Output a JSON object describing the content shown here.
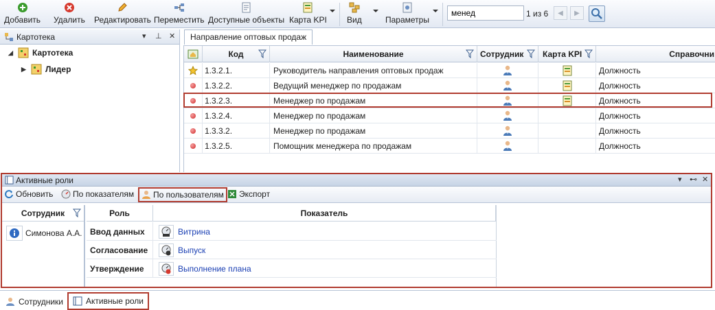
{
  "toolbar": {
    "add": "Добавить",
    "delete": "Удалить",
    "edit": "Редактировать",
    "move": "Переместить",
    "available": "Доступные объекты",
    "kpi_map": "Карта KPI",
    "view": "Вид",
    "params": "Параметры",
    "search_value": "менед",
    "search_count": "1 из 6"
  },
  "left_panel": {
    "title": "Картотека",
    "tree": [
      {
        "label": "Картотека"
      },
      {
        "label": "Лидер"
      }
    ]
  },
  "tab": {
    "label": "Направление оптовых продаж"
  },
  "grid": {
    "headers": {
      "code": "Код",
      "name": "Наименование",
      "employee": "Сотрудник",
      "kpi": "Карта KPI",
      "ref": "Справочни"
    },
    "rows": [
      {
        "marker": "star",
        "code": "1.3.2.1.",
        "name": "Руководитель направления оптовых продаж",
        "has_kpi": true,
        "ref": "Должность"
      },
      {
        "marker": "dot",
        "code": "1.3.2.2.",
        "name": "Ведущий менеджер по продажам",
        "has_kpi": true,
        "ref": "Должность"
      },
      {
        "marker": "dot",
        "code": "1.3.2.3.",
        "name": "Менеджер по продажам",
        "has_kpi": true,
        "ref": "Должность"
      },
      {
        "marker": "dot",
        "code": "1.3.2.4.",
        "name": "Менеджер по продажам",
        "has_kpi": false,
        "ref": "Должность"
      },
      {
        "marker": "dot",
        "code": "1.3.3.2.",
        "name": "Менеджер по продажам",
        "has_kpi": false,
        "ref": "Должность"
      },
      {
        "marker": "dot",
        "code": "1.3.2.5.",
        "name": "Помощник менеджера по продажам",
        "has_kpi": false,
        "ref": "Должность"
      }
    ]
  },
  "roles_panel": {
    "title": "Активные роли",
    "buttons": {
      "refresh": "Обновить",
      "by_indicators": "По показателям",
      "by_users": "По пользователям",
      "export": "Экспорт"
    },
    "employee_header": "Сотрудник",
    "employee": "Симонова А.А.",
    "role_header": "Роль",
    "indicator_header": "Показатель",
    "rows": [
      {
        "role": "Ввод данных",
        "indicator": "Витрина"
      },
      {
        "role": "Согласование",
        "indicator": "Выпуск"
      },
      {
        "role": "Утверждение",
        "indicator": "Выполнение плана"
      }
    ]
  },
  "bottom_tabs": {
    "employees": "Сотрудники",
    "active_roles": "Активные роли"
  },
  "colors": {
    "highlight": "#b03a2e",
    "link": "#1a3fb3"
  }
}
